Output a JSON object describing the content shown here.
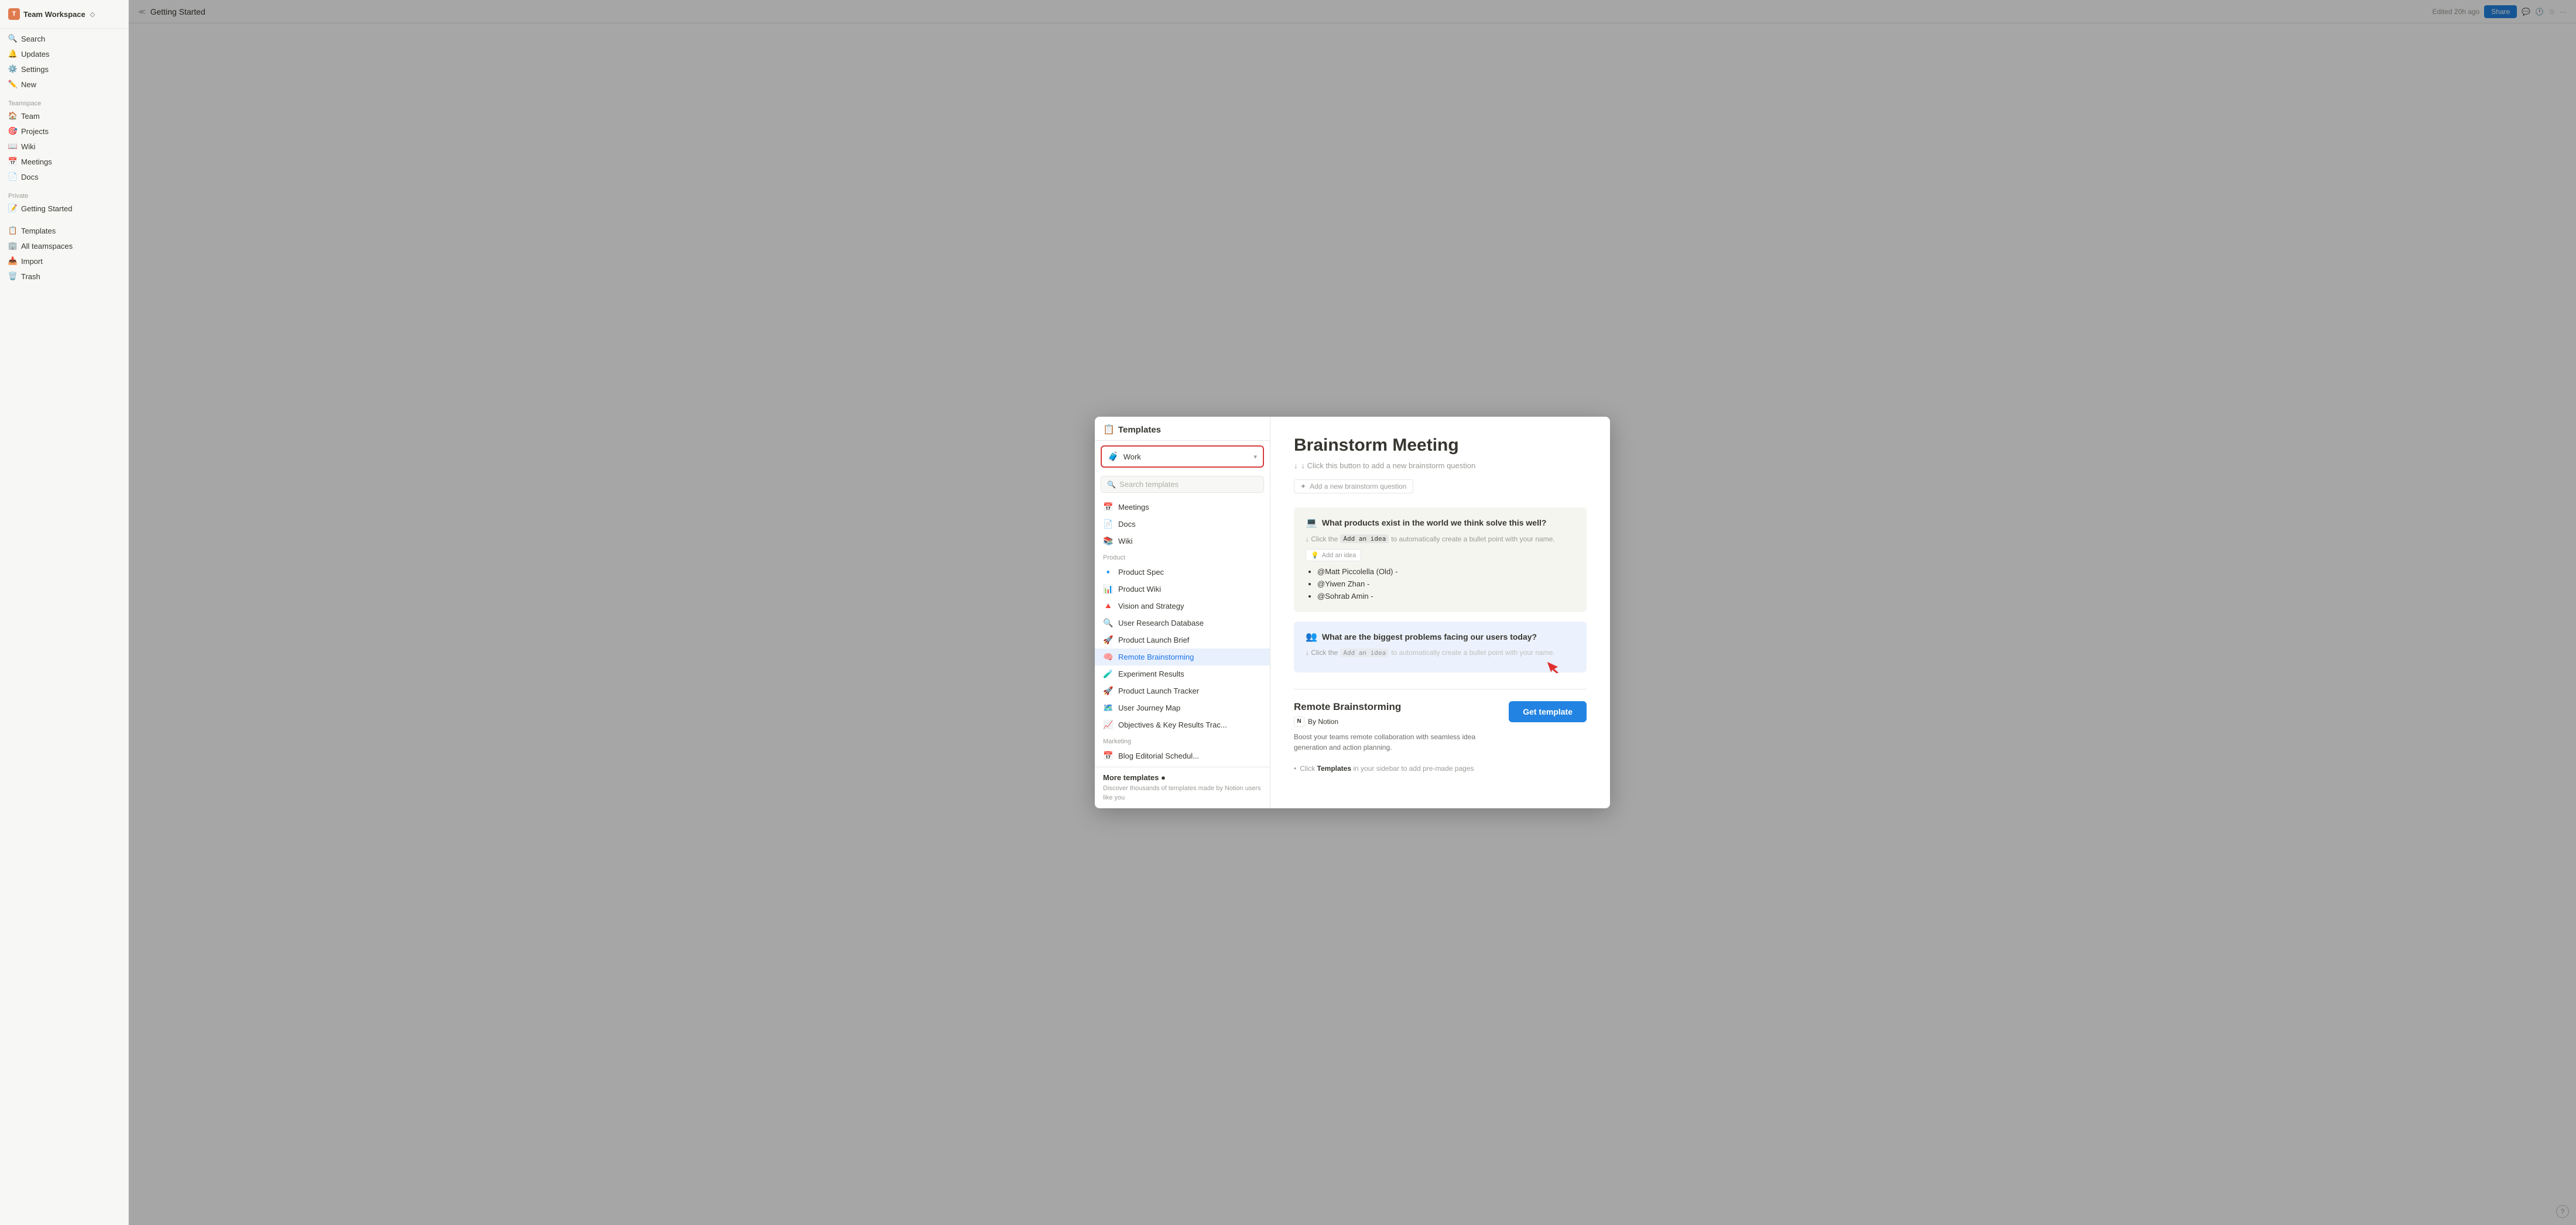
{
  "app": {
    "workspace_name": "Team Workspace",
    "page_title": "Getting Started",
    "edited_time": "Edited 20h ago",
    "share_label": "Share"
  },
  "sidebar": {
    "search_label": "Search",
    "updates_label": "Updates",
    "settings_label": "Settings",
    "new_label": "New",
    "teamspace_section": "Teamspace",
    "teamspace_items": [
      {
        "icon": "🏠",
        "label": "Team"
      },
      {
        "icon": "🎯",
        "label": "Projects"
      },
      {
        "icon": "📖",
        "label": "Wiki"
      },
      {
        "icon": "📅",
        "label": "Meetings"
      },
      {
        "icon": "📄",
        "label": "Docs"
      }
    ],
    "private_section": "Private",
    "private_items": [
      {
        "icon": "📝",
        "label": "Getting Started"
      }
    ]
  },
  "modal": {
    "header": "Templates",
    "dropdown_label": "Work",
    "dropdown_emoji": "🧳",
    "search_placeholder": "Search templates",
    "sections": [
      {
        "label": "",
        "items": [
          {
            "icon": "📅",
            "label": "Meetings"
          },
          {
            "icon": "📄",
            "label": "Docs"
          },
          {
            "icon": "📚",
            "label": "Wiki"
          }
        ]
      },
      {
        "label": "Product",
        "items": [
          {
            "icon": "🔹",
            "label": "Product Spec"
          },
          {
            "icon": "📊",
            "label": "Product Wiki"
          },
          {
            "icon": "🔺",
            "label": "Vision and Strategy"
          },
          {
            "icon": "🔍",
            "label": "User Research Database"
          },
          {
            "icon": "🚀",
            "label": "Product Launch Brief"
          },
          {
            "icon": "🧠",
            "label": "Remote Brainstorming",
            "active": true
          },
          {
            "icon": "🧪",
            "label": "Experiment Results"
          },
          {
            "icon": "🚀",
            "label": "Product Launch Tracker"
          },
          {
            "icon": "🗺️",
            "label": "User Journey Map"
          },
          {
            "icon": "📈",
            "label": "Objectives & Key Results Trac..."
          }
        ]
      },
      {
        "label": "Marketing",
        "items": [
          {
            "icon": "📅",
            "label": "Blog Editorial Schedul..."
          }
        ]
      }
    ],
    "more_templates_title": "More templates ●",
    "more_templates_desc": "Discover thousands of templates made by Notion users like you"
  },
  "content": {
    "title": "Brainstorm Meeting",
    "subtitle": "↓ Click this button to add a new brainstorm question",
    "add_question_label": "Add a new brainstorm question",
    "question1": {
      "icon": "💻",
      "text": "What products exist in the world we think solve this well?",
      "subtitle_pre": "↓ Click the",
      "code_chip": "Add an idea",
      "subtitle_post": "to automatically create a bullet point with your name.",
      "add_idea_label": "Add an idea",
      "bullets": [
        "@Matt Piccolella (Old) -",
        "@Yiwen Zhan -",
        "@Sohrab Amin -"
      ]
    },
    "question2": {
      "icon": "👥",
      "text": "What are the biggest problems facing our users today?",
      "subtitle_pre": "↓ Click the",
      "code_chip": "Add an idea",
      "subtitle_post": "to automatically create a bullet point with your name."
    },
    "bottom": {
      "template_name": "Remote Brainstorming",
      "by_label": "By Notion",
      "description": "Boost your teams remote collaboration with seamless idea generation and action planning.",
      "get_template_label": "Get template"
    },
    "hint": {
      "text_pre": "Click ",
      "text_bold": "Templates",
      "text_post": " in your sidebar to add pre-made pages"
    }
  }
}
